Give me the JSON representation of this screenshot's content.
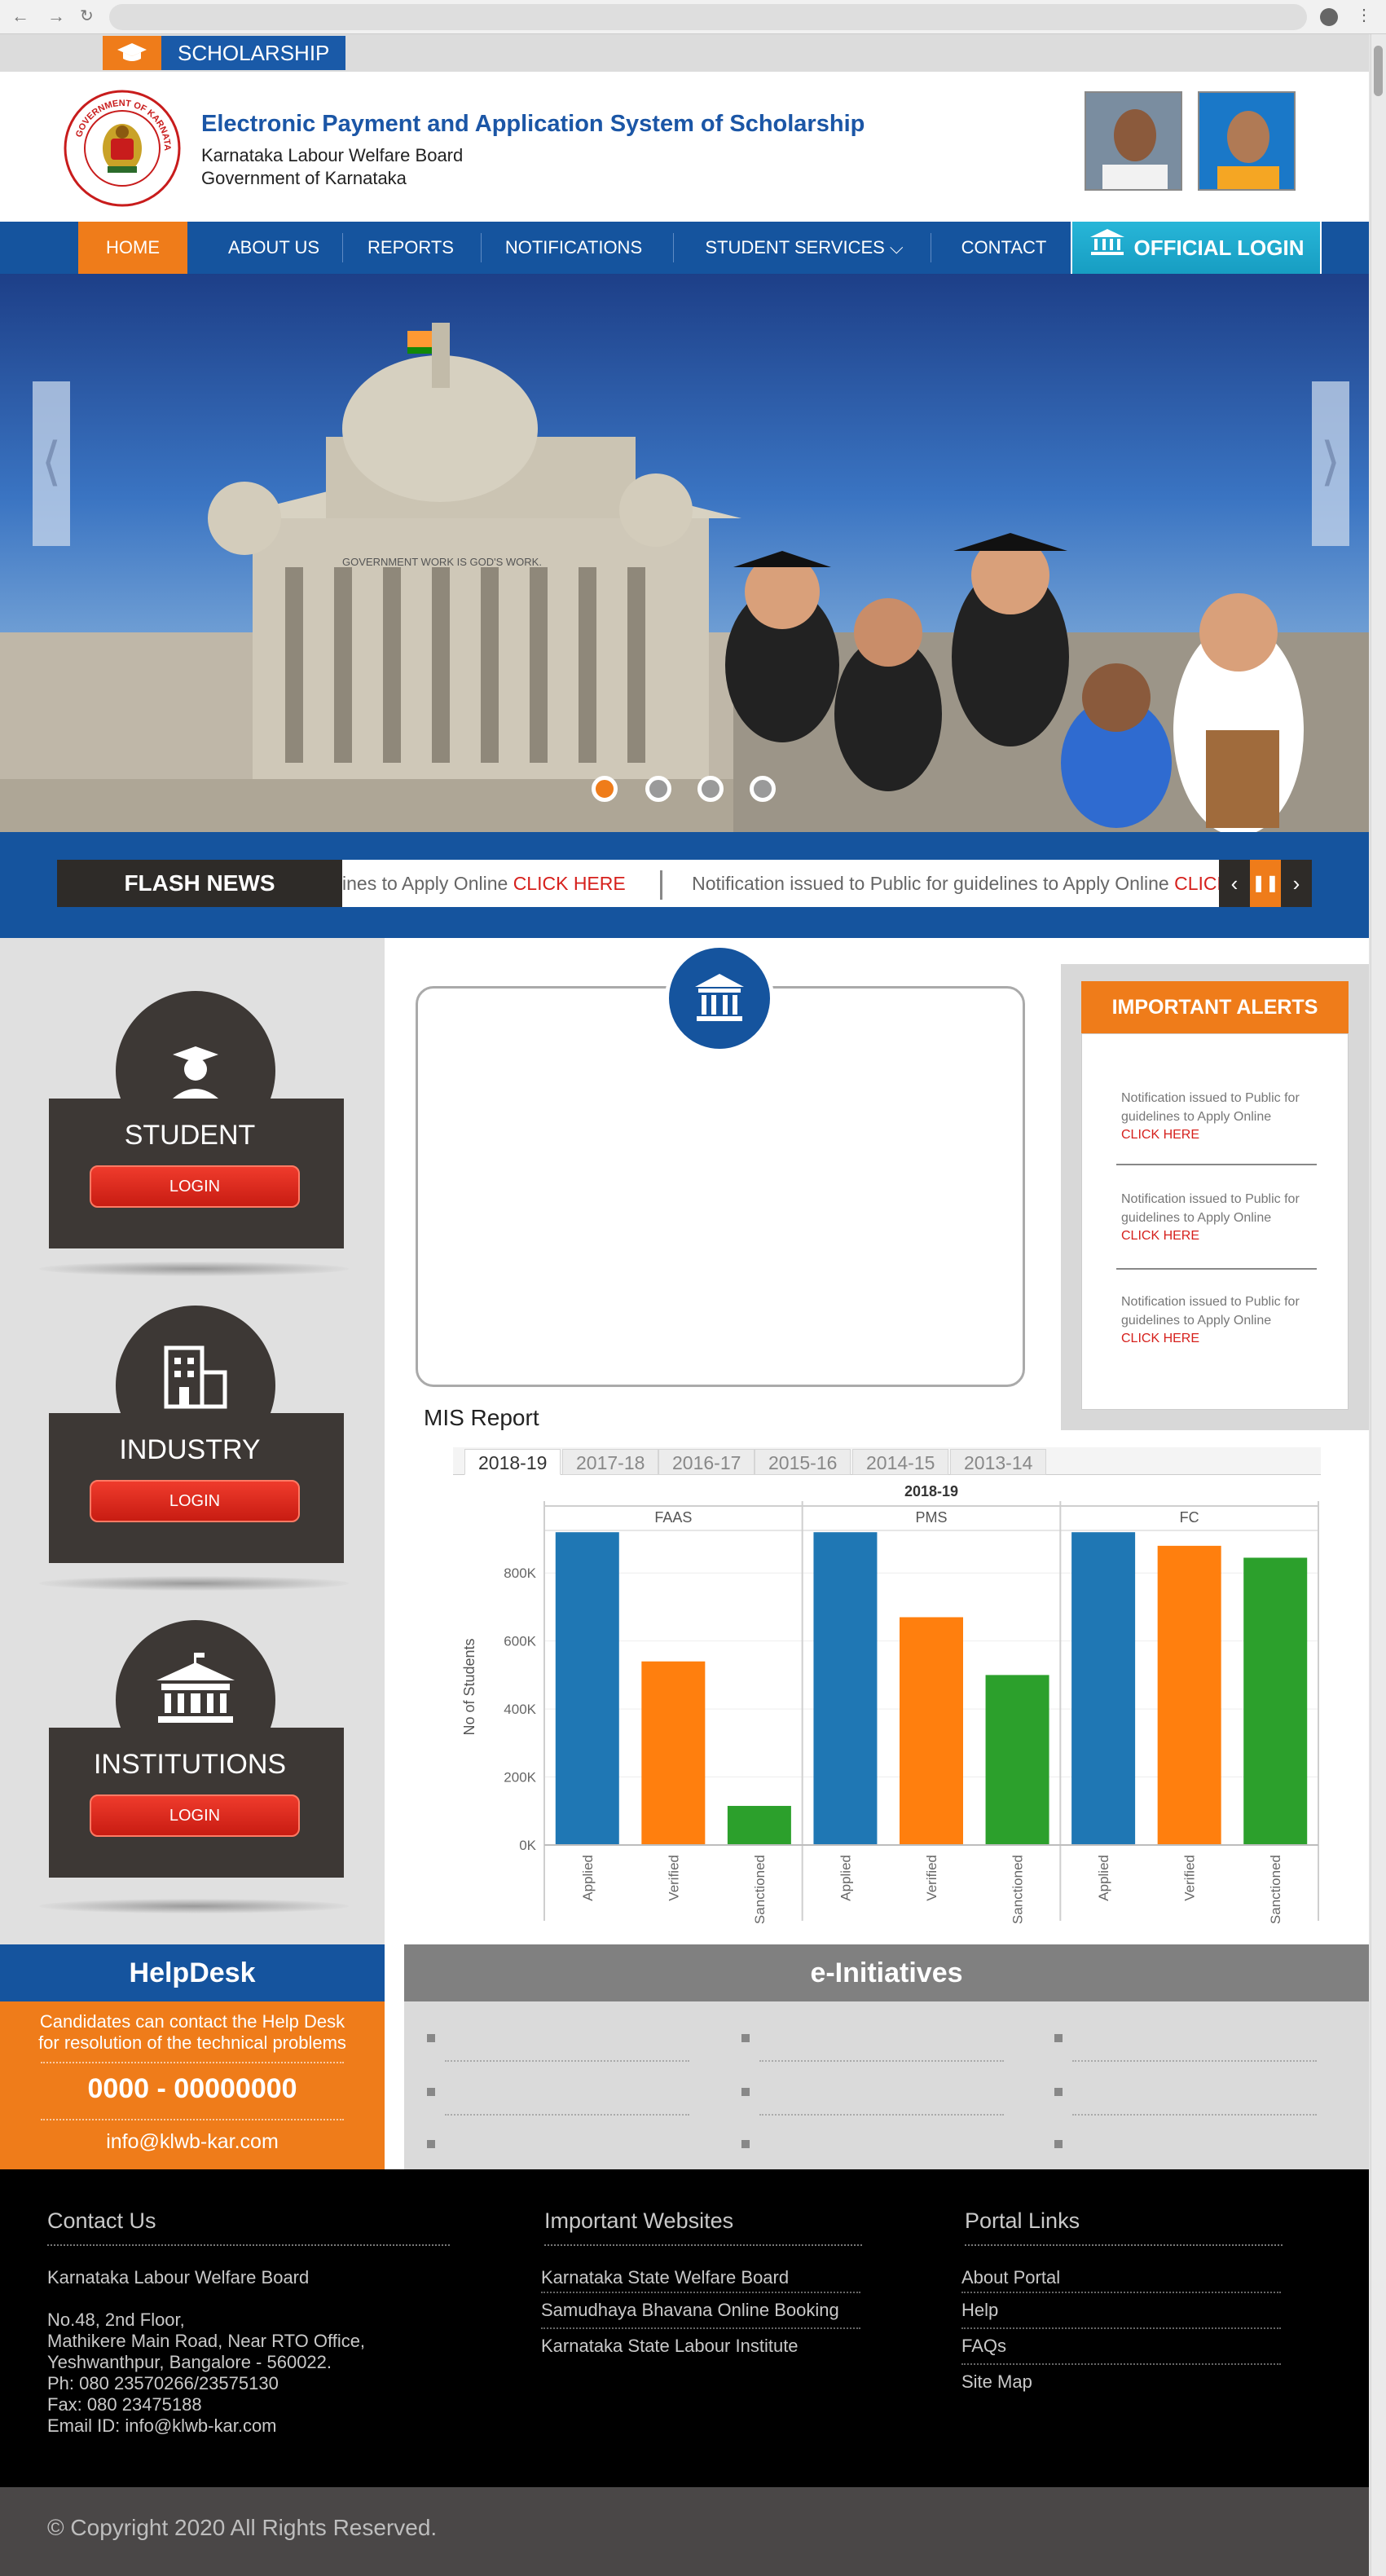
{
  "header": {
    "section_label": "SCHOLARSHIP",
    "title": "Electronic Payment and Application System of Scholarship",
    "subtitle1": "Karnataka Labour Welfare Board",
    "subtitle2": "Government of Karnataka",
    "emblem_text": "GOVERNMENT OF KARNATAKA"
  },
  "nav": {
    "home": "HOME",
    "about": "ABOUT US",
    "reports": "REPORTS",
    "notifications": "NOTIFICATIONS",
    "student_services": "STUDENT SERVICES ⌵",
    "contact": "CONTACT",
    "official_login": "OFFICIAL LOGIN"
  },
  "hero": {
    "building_inscription": "GOVERNMENT WORK IS GOD'S WORK."
  },
  "flash": {
    "label": "FLASH NEWS",
    "items": [
      {
        "text": "ines to Apply Online ",
        "link": "CLICK HERE"
      },
      {
        "text": "Notification issued to Public for guidelines to Apply Online ",
        "link": "CLICK HERE"
      }
    ]
  },
  "logins": [
    {
      "title": "STUDENT",
      "button": "LOGIN"
    },
    {
      "title": "INDUSTRY",
      "button": "LOGIN"
    },
    {
      "title": "INSTITUTIONS",
      "button": "LOGIN"
    }
  ],
  "mis": {
    "title": "MIS Report",
    "tabs": [
      "2018-19",
      "2017-18",
      "2016-17",
      "2015-16",
      "2014-15",
      "2013-14"
    ],
    "active_tab": "2018-19"
  },
  "chart_data": {
    "type": "bar",
    "title": "2018-19",
    "ylabel": "No of Students",
    "ylim": [
      0,
      930000
    ],
    "yticks": [
      "0K",
      "200K",
      "400K",
      "600K",
      "800K"
    ],
    "ytick_values": [
      0,
      200000,
      400000,
      600000,
      800000
    ],
    "panels": [
      "FAAS",
      "PMS",
      "FC"
    ],
    "categories": [
      "Applied",
      "Verified",
      "Sanctioned"
    ],
    "colors": [
      "#1f77b4",
      "#ff7f0e",
      "#2ca02c"
    ],
    "values": [
      [
        920000,
        540000,
        115000
      ],
      [
        920000,
        670000,
        500000
      ],
      [
        920000,
        880000,
        845000
      ]
    ]
  },
  "alerts": {
    "heading": "IMPORTANT ALERTS",
    "items": [
      {
        "text": "Notification issued to Public for guidelines to Apply Online",
        "link": "CLICK HERE"
      },
      {
        "text": "Notification issued to Public for guidelines to Apply Online",
        "link": "CLICK HERE"
      },
      {
        "text": "Notification issued to Public for guidelines to Apply Online",
        "link": "CLICK HERE"
      }
    ]
  },
  "helpdesk": {
    "heading": "HelpDesk",
    "line1": "Candidates can contact the Help Desk",
    "line2": "for resolution of the technical problems",
    "phone": "0000 - 00000000",
    "email": "info@klwb-kar.com"
  },
  "einitiatives": {
    "heading": "e-Initiatives"
  },
  "footer": {
    "contact_heading": "Contact Us",
    "org": "Karnataka Labour Welfare Board",
    "address": [
      "No.48, 2nd Floor,",
      "Mathikere Main Road, Near RTO Office,",
      "Yeshwanthpur, Bangalore - 560022.",
      "Ph: 080 23570266/23575130",
      "Fax: 080 23475188",
      "Email ID: info@klwb-kar.com"
    ],
    "websites_heading": "Important Websites",
    "websites": [
      "Karnataka State Welfare Board",
      "Samudhaya Bhavana Online Booking",
      "Karnataka State Labour Institute"
    ],
    "portal_heading": "Portal Links",
    "portal_links": [
      "About Portal",
      "Help",
      "FAQs",
      "Site Map"
    ],
    "copyright": "© Copyright 2020 All Rights Reserved."
  }
}
